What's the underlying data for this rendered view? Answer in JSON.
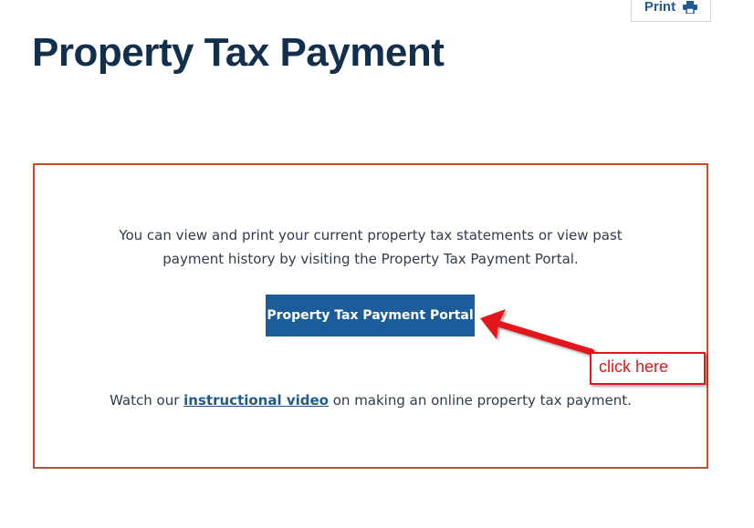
{
  "header": {
    "print_label": "Print",
    "title": "Property Tax Payment"
  },
  "content": {
    "intro_text": "You can view and print your current property tax statements or view past payment history by visiting the Property Tax Payment Portal.",
    "portal_button_label": "Property Tax Payment Portal",
    "video_prefix": "Watch our ",
    "video_link_label": "instructional video",
    "video_suffix": " on making an online property tax payment."
  },
  "annotation": {
    "label": "click here"
  },
  "colors": {
    "title": "#12304e",
    "link": "#1f5a93",
    "button": "#1b5d9b",
    "box_border": "#c9501e",
    "annotation_red": "#e3161b"
  },
  "icons": {
    "print": "printer-icon",
    "arrow": "arrow-left-icon"
  }
}
